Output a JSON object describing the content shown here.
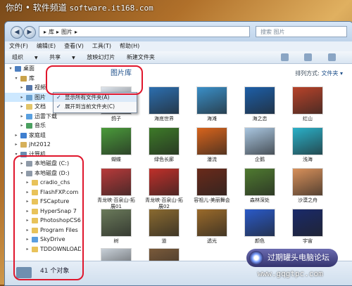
{
  "watermark": {
    "prefix": "你的 • 软件频道",
    "site": "software.it168.com"
  },
  "address_bar": {
    "crumbs": [
      "▸",
      "库",
      "▸",
      "图片",
      "▸"
    ],
    "search_placeholder": "搜索 图片"
  },
  "menu": [
    "文件(F)",
    "编辑(E)",
    "查看(V)",
    "工具(T)",
    "帮助(H)"
  ],
  "toolbar": {
    "organize": "组织",
    "share": "共享",
    "slideshow": "放映幻灯片",
    "new_folder": "新建文件夹"
  },
  "sidebar": {
    "items": [
      {
        "label": "桌面",
        "indent": 0,
        "arrow": "▾",
        "icon": "desktop-icon",
        "color": "#4d7fc0"
      },
      {
        "label": "库",
        "indent": 1,
        "arrow": "▾",
        "icon": "library-icon",
        "color": "#c9a24a"
      },
      {
        "label": "视频",
        "indent": 2,
        "arrow": "▸",
        "icon": "video-icon",
        "color": "#5576a8"
      },
      {
        "label": "图片",
        "indent": 2,
        "arrow": "▸",
        "icon": "pictures-icon",
        "color": "#6aa0cf",
        "selected": true
      },
      {
        "label": "文档",
        "indent": 2,
        "arrow": "▸",
        "icon": "documents-icon",
        "color": "#e2c56a"
      },
      {
        "label": "迅雷下载",
        "indent": 2,
        "arrow": "▸",
        "icon": "download-icon",
        "color": "#5aa0e0"
      },
      {
        "label": "音乐",
        "indent": 2,
        "arrow": "▸",
        "icon": "music-icon",
        "color": "#4aa060"
      },
      {
        "label": "家庭组",
        "indent": 1,
        "arrow": "▸",
        "icon": "homegroup-icon",
        "color": "#3f7fd0"
      },
      {
        "label": "jht2012",
        "indent": 1,
        "arrow": "▸",
        "icon": "user-icon",
        "color": "#d6b05a"
      },
      {
        "label": "计算机",
        "indent": 1,
        "arrow": "▾",
        "icon": "computer-icon",
        "color": "#6b8cb0"
      },
      {
        "label": "本地磁盘 (C:)",
        "indent": 2,
        "arrow": "▸",
        "icon": "drive-icon",
        "color": "#8f9aa8"
      },
      {
        "label": "本地磁盘 (D:)",
        "indent": 2,
        "arrow": "▾",
        "icon": "drive-icon",
        "color": "#8f9aa8"
      },
      {
        "label": "cradio_chs",
        "indent": 3,
        "arrow": "▸",
        "icon": "folder-icon",
        "color": "#e8c25a"
      },
      {
        "label": "FlashFXP.com",
        "indent": 3,
        "arrow": "▸",
        "icon": "folder-icon",
        "color": "#e8c25a"
      },
      {
        "label": "FSCapture",
        "indent": 3,
        "arrow": "▸",
        "icon": "folder-icon",
        "color": "#e8c25a"
      },
      {
        "label": "HyperSnap 7",
        "indent": 3,
        "arrow": "▸",
        "icon": "folder-icon",
        "color": "#e8c25a"
      },
      {
        "label": "PhotoshopCS6",
        "indent": 3,
        "arrow": "▸",
        "icon": "folder-icon",
        "color": "#e8c25a"
      },
      {
        "label": "Program Files",
        "indent": 3,
        "arrow": "▸",
        "icon": "folder-icon",
        "color": "#e8c25a"
      },
      {
        "label": "SkyDrive",
        "indent": 3,
        "arrow": "▸",
        "icon": "folder-icon",
        "color": "#5a9ee0"
      },
      {
        "label": "TDDOWNLOAD",
        "indent": 3,
        "arrow": "▸",
        "icon": "folder-icon",
        "color": "#e8c25a"
      }
    ]
  },
  "context_menu": [
    {
      "label": "显示所有文件夹(A)",
      "checked": true
    },
    {
      "label": "展开到当前文件夹(C)",
      "checked": true
    }
  ],
  "library": {
    "title": "图片库",
    "arrange_label": "排列方式:",
    "arrange_value": "文件夹 ▾"
  },
  "photos": [
    {
      "label": "鸽子",
      "color": "#dfe6ee"
    },
    {
      "label": "海底世界",
      "color": "#2c6fb0"
    },
    {
      "label": "海滩",
      "color": "#3a8fc8"
    },
    {
      "label": "海之恋",
      "color": "#1d5fa8"
    },
    {
      "label": "红山",
      "color": "#b8432a"
    },
    {
      "label": "蝴蝶",
      "color": "#4a9a3a"
    },
    {
      "label": "绿色长廊",
      "color": "#3d7a28"
    },
    {
      "label": "瀑流",
      "color": "#d8641c"
    },
    {
      "label": "企鹅",
      "color": "#a9c6e0"
    },
    {
      "label": "浅海",
      "color": "#2ab0c8"
    },
    {
      "label": "青龙峡·百泉山-拓展01",
      "color": "#b83a3a"
    },
    {
      "label": "青龙峡·百泉山-拓展02",
      "color": "#c0302a"
    },
    {
      "label": "容祖儿-美丽舞会",
      "color": "#6a2a1a"
    },
    {
      "label": "森林深处",
      "color": "#4f7a30"
    },
    {
      "label": "沙漠之舟",
      "color": "#d8905a"
    },
    {
      "label": "树",
      "color": "#6a7a5a"
    },
    {
      "label": "道",
      "color": "#8a6a30"
    },
    {
      "label": "透光",
      "color": "#9a6a2a"
    },
    {
      "label": "颜色",
      "color": "#2a5ac8"
    },
    {
      "label": "宇宙",
      "color": "#1a2a6a"
    },
    {
      "label": "",
      "color": "#c8d0d8"
    },
    {
      "label": "",
      "color": "#7a5a3a"
    }
  ],
  "status": {
    "count": "41 个对象"
  },
  "forum": {
    "name": "过期罐头电脑论坛",
    "url": "www.gqgtpc.com"
  }
}
